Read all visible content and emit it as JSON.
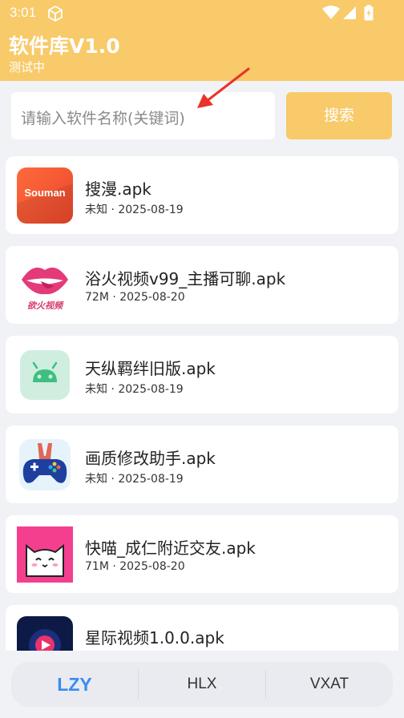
{
  "status_bar": {
    "time": "3:01"
  },
  "header": {
    "title": "软件库V1.0",
    "subtitle": "测试中"
  },
  "search": {
    "placeholder": "请输入软件名称(关键词)",
    "button_label": "搜索"
  },
  "apps": [
    {
      "name": "搜漫.apk",
      "meta": "未知 · 2025-08-19",
      "icon_text": "Souman",
      "icon": "souman-logo-icon"
    },
    {
      "name": "浴火视频v99_主播可聊.apk",
      "meta": "72M · 2025-08-20",
      "icon_text": "欲火视频",
      "icon": "lips-logo-icon"
    },
    {
      "name": "天纵羁绊旧版.apk",
      "meta": "未知 · 2025-08-19",
      "icon": "android-icon"
    },
    {
      "name": "画质修改助手.apk",
      "meta": "未知 · 2025-08-19",
      "icon": "gamepad-icon"
    },
    {
      "name": "快喵_成仁附近交友.apk",
      "meta": "71M · 2025-08-20",
      "icon": "cat-icon"
    },
    {
      "name": "星际视频1.0.0.apk",
      "meta": "",
      "icon": "play-icon"
    }
  ],
  "tabs": [
    {
      "label": "LZY",
      "active": true
    },
    {
      "label": "HLX",
      "active": false
    },
    {
      "label": "VXAT",
      "active": false
    }
  ],
  "colors": {
    "accent": "#f8ca6a",
    "active_tab": "#3b8bf0",
    "background": "#f1f2f6"
  }
}
